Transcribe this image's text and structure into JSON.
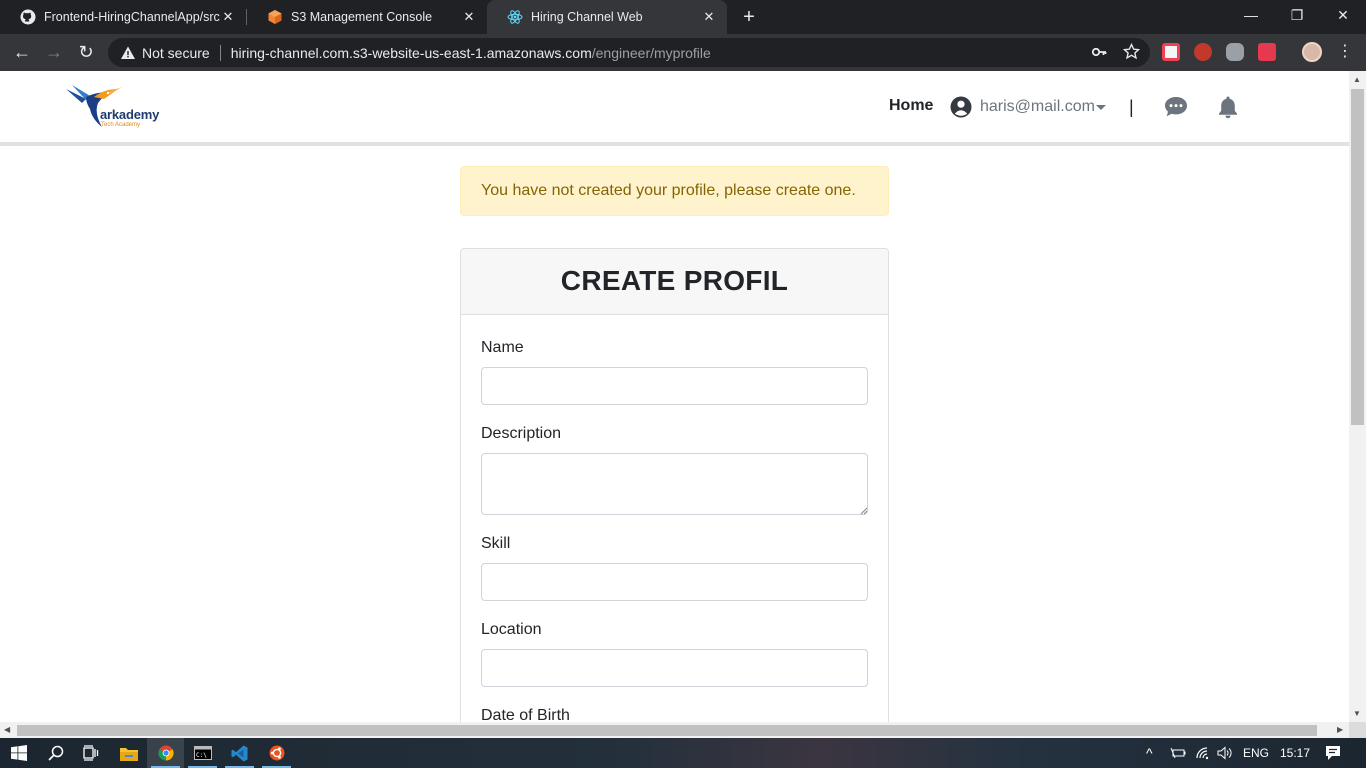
{
  "browser": {
    "tabs": [
      {
        "title": "Frontend-HiringChannelApp/src/",
        "favicon": "github-icon"
      },
      {
        "title": "S3 Management Console",
        "favicon": "aws-cube-icon"
      },
      {
        "title": "Hiring Channel Web",
        "favicon": "react-atom-icon"
      }
    ],
    "active_tab": 2,
    "new_tab": "+",
    "window_controls": {
      "minimize": "—",
      "restore": "❐",
      "close": "✕"
    },
    "security_label": "Not secure",
    "url_host": "hiring-channel.com.s3-website-us-east-1.amazonaws.com",
    "url_path": "/engineer/myprofile",
    "nav": {
      "back": "←",
      "forward": "→",
      "reload": "↻"
    },
    "omnibox_icons": {
      "key": "key-icon",
      "star": "star-icon"
    },
    "extensions": [
      {
        "name": "pocket-ext-icon",
        "color": "#ef4056"
      },
      {
        "name": "ublock-ext-icon",
        "color": "#c0392b"
      },
      {
        "name": "gear-cloud-ext-icon",
        "color": "#9aa0a6"
      },
      {
        "name": "cast-ext-icon",
        "color": "#e53950"
      }
    ],
    "menu_glyph": "⋮"
  },
  "site": {
    "logo_text": "arkademy",
    "logo_subtext": "Tech Academy",
    "nav_home": "Home",
    "user_email": "haris@mail.com",
    "separator": "|",
    "icons": {
      "user": "user-circle-icon",
      "chat": "chat-icon",
      "bell": "bell-icon"
    }
  },
  "alert": {
    "message": "You have not created your profile, please create one."
  },
  "form": {
    "title": "CREATE PROFIL",
    "fields": {
      "name": {
        "label": "Name",
        "value": ""
      },
      "description": {
        "label": "Description",
        "value": ""
      },
      "skill": {
        "label": "Skill",
        "value": ""
      },
      "location": {
        "label": "Location",
        "value": ""
      },
      "dob": {
        "label": "Date of Birth"
      }
    }
  },
  "taskbar": {
    "apps": [
      "windows-start-icon",
      "search-icon",
      "task-view-icon",
      "file-explorer-icon",
      "chrome-icon",
      "terminal-icon",
      "vscode-icon",
      "ubuntu-icon"
    ],
    "tray": {
      "language": "ENG",
      "time": "15:17",
      "chevron": "^"
    }
  },
  "colors": {
    "alert_bg": "#fff3cd",
    "alert_text": "#856404",
    "chrome_dark": "#202124",
    "chrome_mid": "#35363a"
  }
}
